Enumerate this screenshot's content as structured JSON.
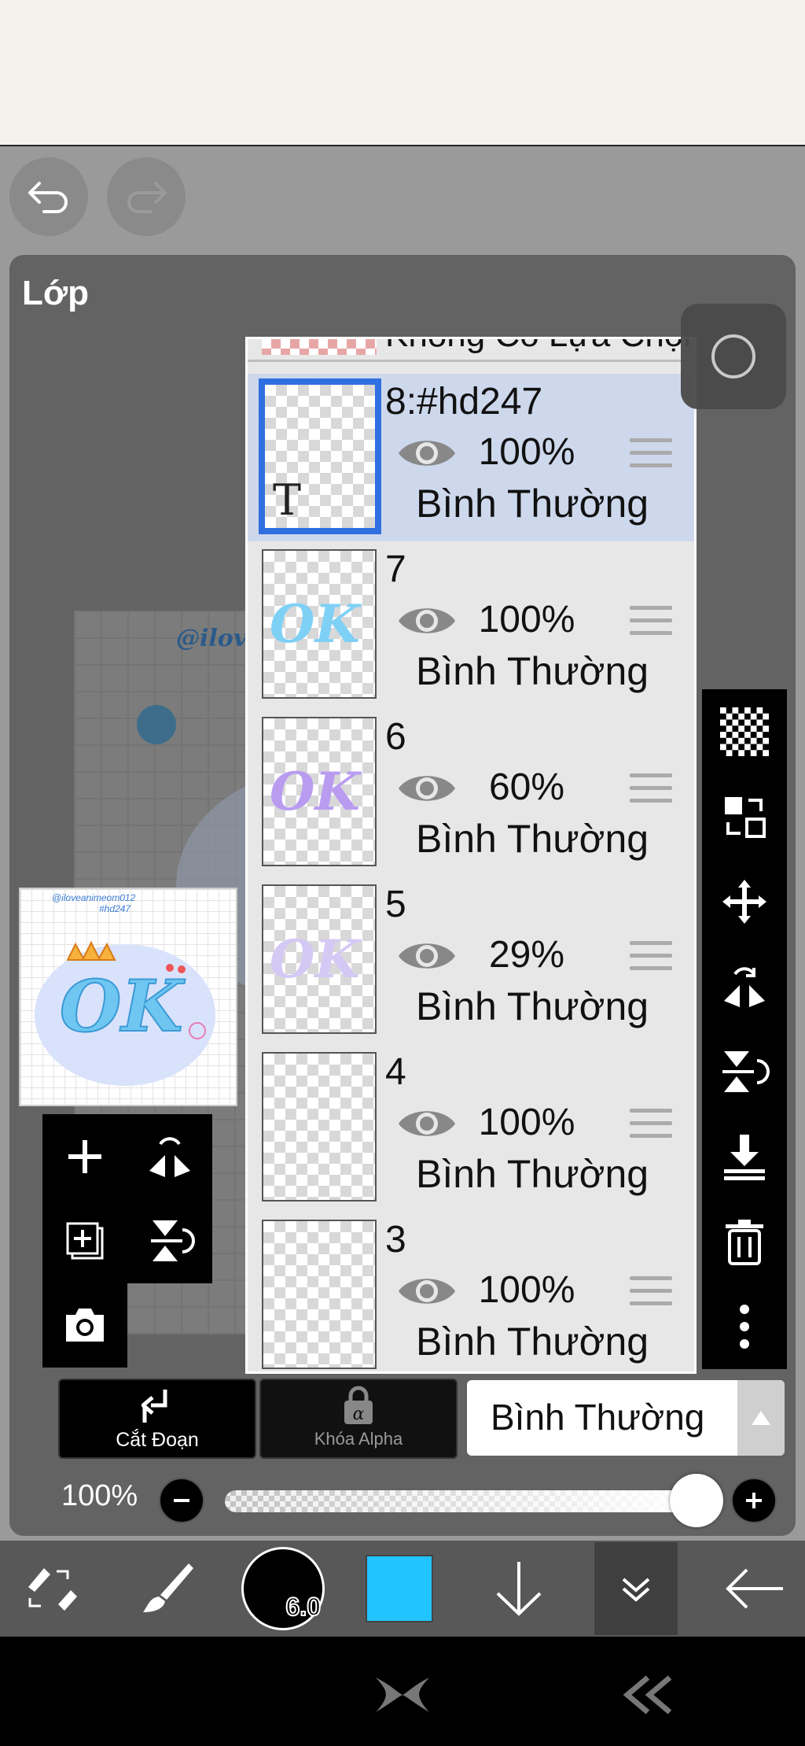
{
  "panel": {
    "title": "Lớp"
  },
  "layers": {
    "top_partial_label": "Không Có Lựa Chọn",
    "items": [
      {
        "name": "8:#hd247",
        "opacity": "100%",
        "blend": "Bình Thường",
        "selected": true,
        "type": "text"
      },
      {
        "name": "7",
        "opacity": "100%",
        "blend": "Bình Thường",
        "thumb_color": "#7fd0f5"
      },
      {
        "name": "6",
        "opacity": "60%",
        "blend": "Bình Thường",
        "thumb_color": "#b99cf0"
      },
      {
        "name": "5",
        "opacity": "29%",
        "blend": "Bình Thường",
        "thumb_color": "#d4c9f4"
      },
      {
        "name": "4",
        "opacity": "100%",
        "blend": "Bình Thường"
      },
      {
        "name": "3",
        "opacity": "100%",
        "blend": "Bình Thường"
      }
    ]
  },
  "actions": {
    "clip_label": "Cắt Đoạn",
    "alpha_lock_label": "Khóa Alpha",
    "blend_mode": "Bình Thường"
  },
  "opacity": {
    "label": "100%",
    "value": 1.0
  },
  "toolbar": {
    "brush_size": "6.0",
    "color": "#22c4ff"
  },
  "preview": {
    "watermark": "@iloveanimeom012",
    "tag": "#hd247"
  },
  "canvas": {
    "watermark": "@ilov"
  }
}
